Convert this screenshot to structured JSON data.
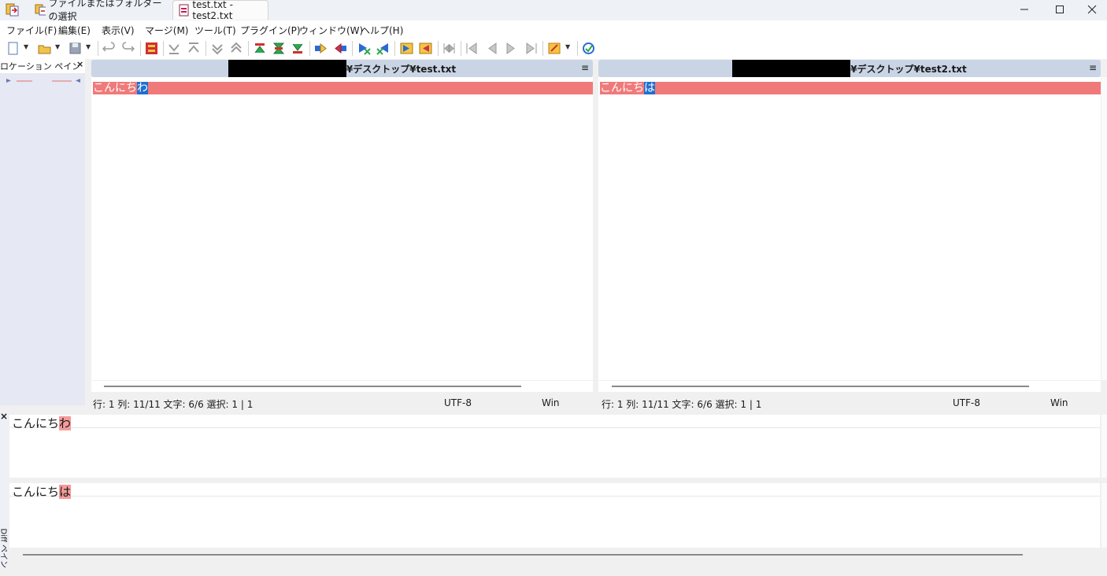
{
  "titlebar": {
    "tabs": [
      {
        "label": "ファイルまたはフォルダーの選択"
      },
      {
        "label": "test.txt - test2.txt"
      }
    ],
    "minimize": "—",
    "maximize": "☐",
    "close": "✕"
  },
  "menu": [
    {
      "label": "ファイル(F)"
    },
    {
      "label": "編集(E)"
    },
    {
      "label": "表示(V)"
    },
    {
      "label": "マージ(M)"
    },
    {
      "label": "ツール(T)"
    },
    {
      "label": "プラグイン(P)"
    },
    {
      "label": "ウィンドウ(W)"
    },
    {
      "label": "ヘルプ(H)"
    }
  ],
  "location_pane": {
    "title": "ロケーション ペイン",
    "close": "×"
  },
  "left": {
    "path": "¥デスクトップ¥test.txt",
    "menu_icon": "≡",
    "line_prefix": "こんにち",
    "line_diff": "わ",
    "status": {
      "pos": "行: 1  列: 11/11  文字: 6/6  選択: 1 | 1",
      "encoding": "UTF-8",
      "eol": "Win"
    }
  },
  "right": {
    "path": "¥デスクトップ¥test2.txt",
    "menu_icon": "≡",
    "line_prefix": "こんにち",
    "line_diff": "は",
    "status": {
      "pos": "行: 1  列: 11/11  文字: 6/6  選択: 1 | 1",
      "encoding": "UTF-8",
      "eol": "Win"
    }
  },
  "diff_pane": {
    "title": "Diff ペイン",
    "close": "×",
    "top_prefix": "こんにち",
    "top_diff": "わ",
    "bottom_prefix": "こんにち",
    "bottom_diff": "は"
  },
  "colors": {
    "diff_line": "#f07a7a",
    "diff_char": "#f59a9a",
    "selection": "#1f6fd0",
    "header": "#c9d5e5"
  }
}
